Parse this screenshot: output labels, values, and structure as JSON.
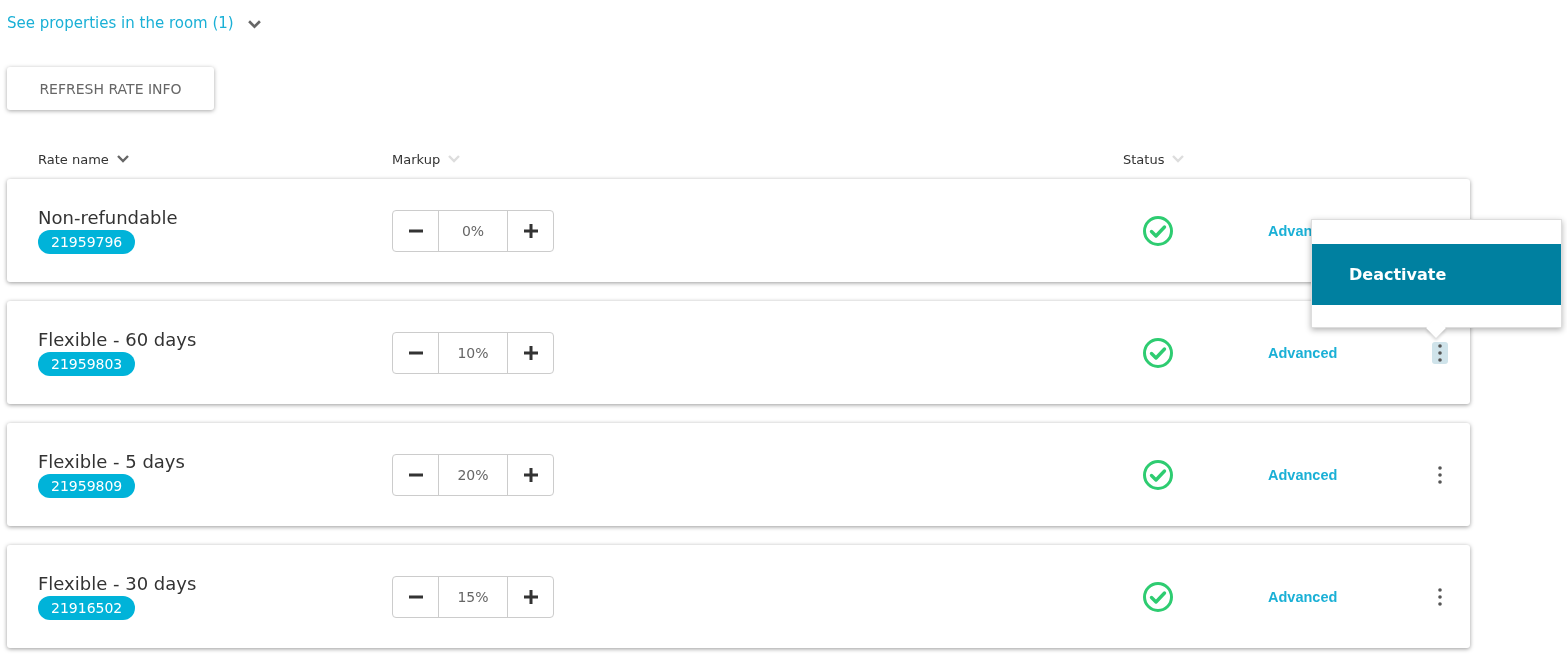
{
  "room_link": {
    "label": "See properties in the room (1)",
    "expanded": false
  },
  "refresh_button": "REFRESH RATE INFO",
  "columns": [
    {
      "label": "Rate name",
      "sorted": true
    },
    {
      "label": "Markup",
      "sorted": false
    },
    {
      "label": "Status",
      "sorted": false
    }
  ],
  "rows": [
    {
      "name": "Non-refundable",
      "code": "21959796",
      "markup": "0%",
      "active": true,
      "advanced": "Advan",
      "menu_open": false
    },
    {
      "name": "Flexible - 60 days",
      "code": "21959803",
      "markup": "10%",
      "active": true,
      "advanced": "Advanced",
      "menu_open": true
    },
    {
      "name": "Flexible - 5 days",
      "code": "21959809",
      "markup": "20%",
      "active": true,
      "advanced": "Advanced",
      "menu_open": false
    },
    {
      "name": "Flexible - 30 days",
      "code": "21916502",
      "markup": "15%",
      "active": true,
      "advanced": "Advanced",
      "menu_open": false
    }
  ],
  "menu": {
    "items": [
      {
        "label": "Deactivate",
        "selected": true
      }
    ]
  }
}
